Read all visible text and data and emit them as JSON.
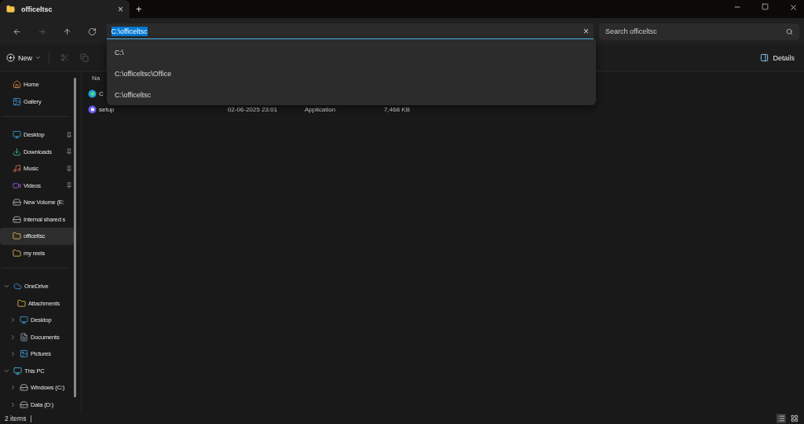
{
  "tab": {
    "title": "officeltsc",
    "close": "×",
    "add": "+"
  },
  "address": {
    "value": "C:\\officeltsc",
    "clear": "×",
    "suggestions": [
      {
        "text": "C:\\"
      },
      {
        "text": "C:\\officeltsc\\Office"
      },
      {
        "text": "C:\\officeltsc"
      }
    ]
  },
  "search": {
    "placeholder": "Search officeltsc"
  },
  "commands": {
    "new": "New",
    "details": "Details"
  },
  "sidebar": {
    "groups": [
      [
        {
          "label": "Home",
          "selected": false
        },
        {
          "label": "Gallery",
          "selected": false
        }
      ],
      [
        {
          "label": "Desktop",
          "pinned": true,
          "selected": false
        },
        {
          "label": "Downloads",
          "pinned": true,
          "selected": false
        },
        {
          "label": "Music",
          "pinned": true,
          "selected": false
        },
        {
          "label": "Videos",
          "pinned": true,
          "selected": false
        },
        {
          "label": "New Volume (E:",
          "pinned": false,
          "selected": false
        },
        {
          "label": "Internal shared s",
          "pinned": false,
          "selected": false
        },
        {
          "label": "officeltsc",
          "pinned": false,
          "selected": true
        },
        {
          "label": "my reels",
          "pinned": false,
          "selected": false
        }
      ],
      [
        {
          "label": "OneDrive",
          "expanded": true,
          "selected": false,
          "children": [
            {
              "label": "Attachments",
              "selected": false
            },
            {
              "label": "Desktop",
              "expanded": false,
              "selected": false
            },
            {
              "label": "Documents",
              "expanded": false,
              "selected": false
            },
            {
              "label": "Pictures",
              "expanded": false,
              "selected": false
            }
          ]
        },
        {
          "label": "This PC",
          "expanded": true,
          "selected": false,
          "children": [
            {
              "label": "Windows (C:)",
              "expanded": false,
              "selected": false
            },
            {
              "label": "Data (D:)",
              "expanded": false,
              "selected": false
            }
          ]
        }
      ]
    ]
  },
  "table": {
    "columns": [
      "Na"
    ],
    "rows": [
      {
        "name": "C"
      },
      {
        "name": "setup",
        "modified": "02-06-2025 23:01",
        "type": "Application",
        "size": "7,468 KB"
      }
    ]
  },
  "status_bar": {
    "count": "2 items",
    "separator": "|"
  }
}
